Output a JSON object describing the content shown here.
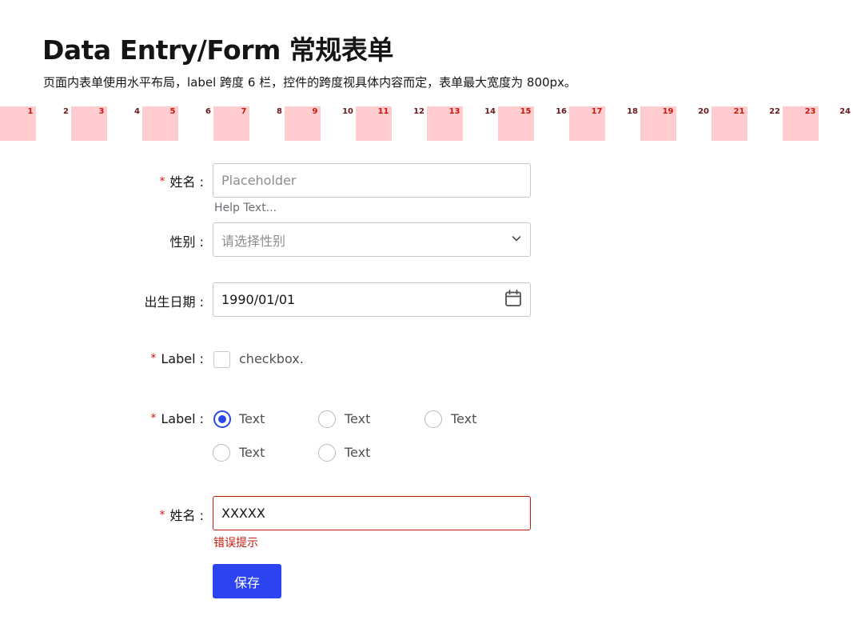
{
  "page": {
    "title": "Data Entry/Form 常规表单",
    "description": "页面内表单使用水平布局，label 跨度 6 栏，控件的跨度视具体内容而定，表单最大宽度为 800px。"
  },
  "grid": {
    "columns": [
      "1",
      "2",
      "3",
      "4",
      "5",
      "6",
      "7",
      "8",
      "9",
      "10",
      "11",
      "12",
      "13",
      "14",
      "15",
      "16",
      "17",
      "18",
      "19",
      "20",
      "21",
      "22",
      "23",
      "24"
    ],
    "shade_color": "#ffcccf",
    "number_color": "#c9190b"
  },
  "form": {
    "name_field": {
      "required_mark": "*",
      "label": "姓名 :",
      "placeholder": "Placeholder",
      "help": "Help Text..."
    },
    "gender_field": {
      "label": "性别 :",
      "placeholder": "请选择性别",
      "icon": "chevron-down-icon"
    },
    "birth_field": {
      "label": "出生日期 :",
      "value": "1990/01/01",
      "icon": "calendar-icon"
    },
    "checkbox_field": {
      "required_mark": "*",
      "label": "Label :",
      "option": "checkbox."
    },
    "radio_field": {
      "required_mark": "*",
      "label": "Label :",
      "options": [
        "Text",
        "Text",
        "Text",
        "Text",
        "Text"
      ],
      "selected_index": 0
    },
    "error_field": {
      "required_mark": "*",
      "label": "姓名 :",
      "value": "XXXXX",
      "error": "错误提示"
    },
    "save_label": "保存"
  },
  "colors": {
    "accent": "#2b43f1",
    "error": "#c9190b",
    "border": "#c7c7c7"
  }
}
